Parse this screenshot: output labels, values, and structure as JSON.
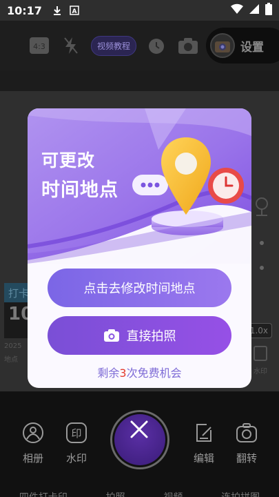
{
  "status_bar": {
    "time": "10:17"
  },
  "top_bar": {
    "tutorial_label": "视频教程",
    "settings_label": "设置"
  },
  "watermark_card": {
    "header": "打卡",
    "big_text": "10",
    "line1": "2025",
    "line2": "地点"
  },
  "zoom": "1.0x",
  "watermark_button_label": "水印",
  "bottom_bar": {
    "album_label": "相册",
    "watermark_label": "水印",
    "edit_label": "编辑",
    "flip_label": "翻转",
    "modes": [
      "四件打卡印",
      "拍照",
      "视频",
      "连拍拼图"
    ]
  },
  "modal": {
    "title_line1": "可更改",
    "title_line2": "时间地点",
    "edit_button": "点击去修改时间地点",
    "shoot_button": "直接拍照",
    "remain_prefix": "剩余",
    "remain_count": "3",
    "remain_suffix": "次免费机会"
  },
  "colors": {
    "primary": "#7b66e6",
    "accent_purple": "#9650e6",
    "count_red": "#e33a2c"
  }
}
